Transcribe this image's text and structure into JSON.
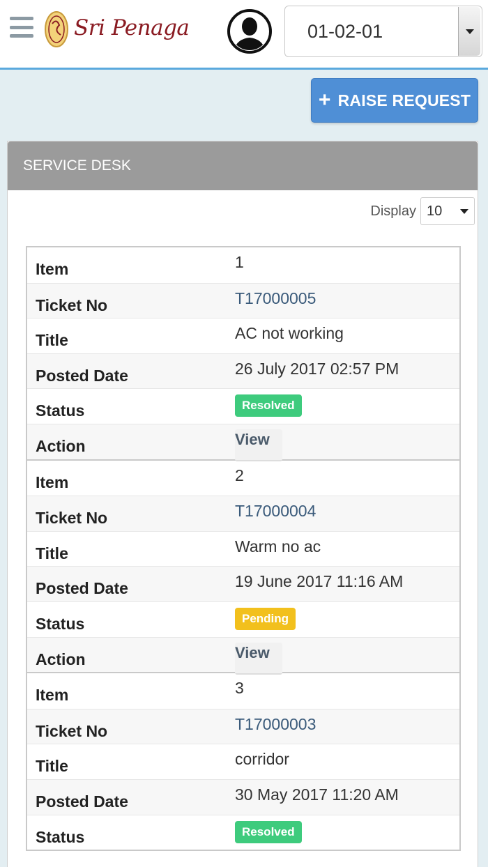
{
  "header": {
    "brand": "Sri Penaga",
    "unit_selected": "01-02-01"
  },
  "actions": {
    "raise_request_label": "RAISE REQUEST"
  },
  "panel": {
    "title": "SERVICE DESK",
    "display_label": "Display",
    "display_value": "10"
  },
  "labels": {
    "item": "Item",
    "ticket_no": "Ticket No",
    "title": "Title",
    "posted_date": "Posted Date",
    "status": "Status",
    "action": "Action",
    "view": "View"
  },
  "colors": {
    "resolved": "#3ecb7d",
    "pending": "#f2c01d",
    "accent": "#4f8fd6"
  },
  "tickets": [
    {
      "item": "1",
      "ticket_no": "T17000005",
      "title": "AC not working",
      "posted_date": "26 July 2017 02:57 PM",
      "status": "Resolved"
    },
    {
      "item": "2",
      "ticket_no": "T17000004",
      "title": "Warm no ac",
      "posted_date": "19 June 2017 11:16 AM",
      "status": "Pending"
    },
    {
      "item": "3",
      "ticket_no": "T17000003",
      "title": "corridor",
      "posted_date": "30 May 2017 11:20 AM",
      "status": "Resolved"
    }
  ]
}
